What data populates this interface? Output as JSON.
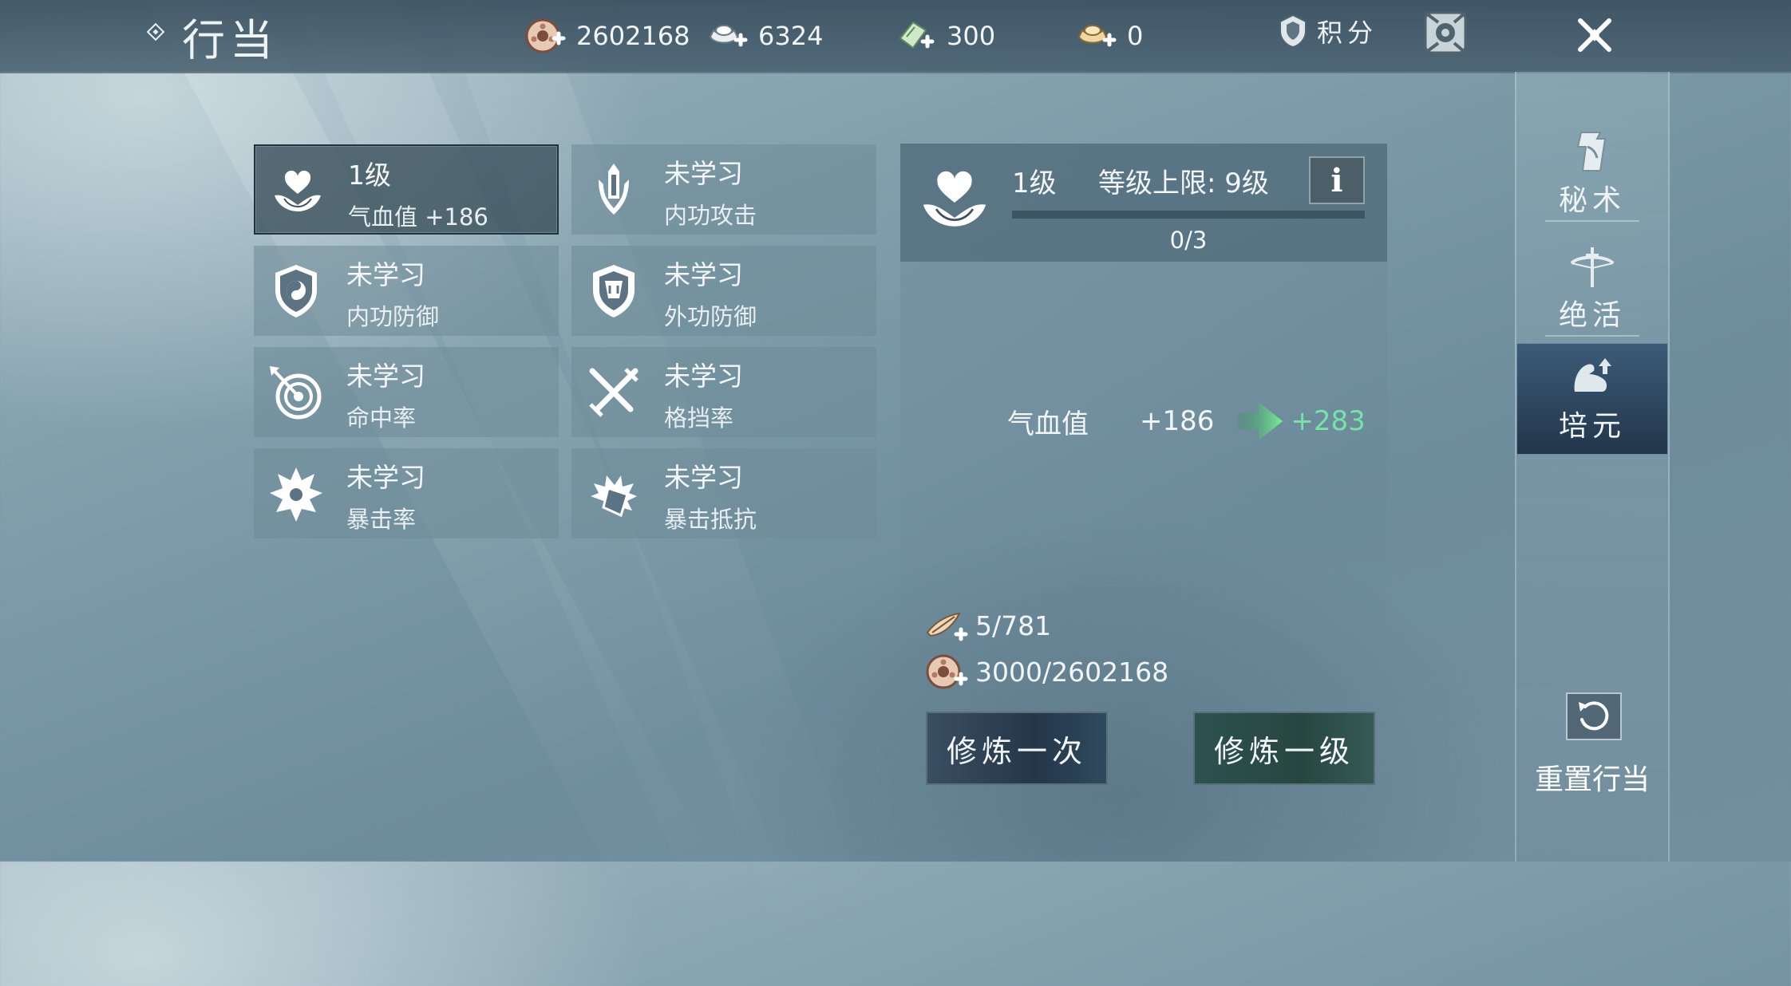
{
  "header": {
    "title": "行当",
    "currencies": [
      {
        "icon": "copper-coin-icon",
        "value": "2602168"
      },
      {
        "icon": "silver-ingot-icon",
        "value": "6324"
      },
      {
        "icon": "jade-ticket-icon",
        "value": "300"
      },
      {
        "icon": "gold-ingot-icon",
        "value": "0"
      }
    ],
    "score_label": "积分"
  },
  "skills": [
    {
      "icon": "lotus-heart-icon",
      "status": "1级",
      "name": "气血值  +186",
      "selected": true
    },
    {
      "icon": "sword-emblem-icon",
      "status": "未学习",
      "name": "内功攻击",
      "selected": false
    },
    {
      "icon": "yin-yang-shield-icon",
      "status": "未学习",
      "name": "内功防御",
      "selected": false
    },
    {
      "icon": "beast-shield-icon",
      "status": "未学习",
      "name": "外功防御",
      "selected": false
    },
    {
      "icon": "target-arrow-icon",
      "status": "未学习",
      "name": "命中率",
      "selected": false
    },
    {
      "icon": "crossed-swords-icon",
      "status": "未学习",
      "name": "格挡率",
      "selected": false
    },
    {
      "icon": "burst-icon",
      "status": "未学习",
      "name": "暴击率",
      "selected": false
    },
    {
      "icon": "shield-burst-icon",
      "status": "未学习",
      "name": "暴击抵抗",
      "selected": false
    }
  ],
  "detail": {
    "icon": "lotus-heart-icon",
    "level": "1级",
    "level_cap": "等级上限: 9级",
    "info_label": "i",
    "progress_text": "0/3",
    "progress_fraction": 0,
    "stat_name": "气血值",
    "stat_current": "+186",
    "stat_next": "+283",
    "costs": [
      {
        "icon": "herb-material-icon",
        "text": "5/781"
      },
      {
        "icon": "copper-coin-icon",
        "text": "3000/2602168"
      }
    ],
    "train_once_label": "修炼一次",
    "train_level_label": "修炼一级"
  },
  "sidebar": {
    "tabs": [
      {
        "icon": "scroll-icon",
        "label": "秘术",
        "active": false
      },
      {
        "icon": "crossbow-icon",
        "label": "绝活",
        "active": false
      },
      {
        "icon": "muscle-arm-icon",
        "label": "培元",
        "active": true
      }
    ],
    "reset_label": "重置行当"
  },
  "colors": {
    "accent_green": "#74e5a8",
    "active_tab": "#2a4560",
    "progress_fill": "#bfe3ff"
  }
}
